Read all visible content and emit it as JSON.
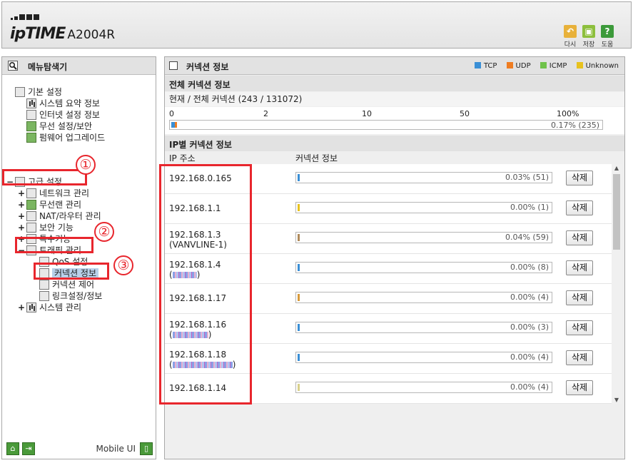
{
  "header": {
    "brand": "ipTIME",
    "model": "A2004R",
    "buttons": [
      {
        "label": "다시",
        "icon": "undo-icon",
        "color": "#e8b13a"
      },
      {
        "label": "저장",
        "icon": "save-icon",
        "color": "#8dbf3d"
      },
      {
        "label": "도움",
        "icon": "help-icon",
        "color": "#3c9a3a"
      }
    ]
  },
  "sidebar": {
    "title": "메뉴탐색기",
    "basic": {
      "label": "기본 설정",
      "items": [
        "시스템 요약 정보",
        "인터넷 설정 정보",
        "무선 설정/보안",
        "펌웨어 업그레이드"
      ]
    },
    "advanced": {
      "label": "고급 설정",
      "items": [
        "네트워크 관리",
        "무선랜 관리",
        "NAT/라우터 관리",
        "보안 기능",
        "특수기능"
      ],
      "traffic": {
        "label": "트래픽 관리",
        "items": [
          "QoS 설정",
          "커넥션 정보",
          "커넥션 제어",
          "링크설정/정보"
        ]
      },
      "system": "시스템 관리"
    },
    "annotations": [
      "①",
      "②",
      "③"
    ],
    "footer": {
      "mobile_ui": "Mobile UI"
    }
  },
  "main": {
    "title": "커넥션 정보",
    "legend": [
      {
        "label": "TCP",
        "color": "#3a8fd6"
      },
      {
        "label": "UDP",
        "color": "#ef7d22"
      },
      {
        "label": "ICMP",
        "color": "#6fc24a"
      },
      {
        "label": "Unknown",
        "color": "#e8c21e"
      }
    ],
    "total": {
      "heading": "전체 커넥션 정보",
      "summary": "현재 / 전체 커넥션 (243 / 131072)",
      "scale": [
        "0",
        "2",
        "10",
        "50",
        "100%"
      ],
      "bar_text": "0.17% (235)",
      "bar_fraction": 0.0017
    },
    "per_ip": {
      "heading": "IP별 커넥션 정보",
      "col_ip": "IP 주소",
      "col_info": "커넥션 정보",
      "delete_label": "삭제",
      "rows": [
        {
          "ip": "192.168.0.165",
          "sub": "",
          "text": "0.03% (51)",
          "color": "#3a8fd6"
        },
        {
          "ip": "192.168.1.1",
          "sub": "",
          "text": "0.00% (1)",
          "color": "#e8c21e"
        },
        {
          "ip": "192.168.1.3",
          "sub": "(VANVLINE-1)",
          "text": "0.04% (59)",
          "color": "#b08a5a"
        },
        {
          "ip": "192.168.1.4",
          "sub": "(",
          "text": "0.00% (8)",
          "color": "#3a8fd6"
        },
        {
          "ip": "192.168.1.17",
          "sub": "",
          "text": "0.00% (4)",
          "color": "#d89a3a"
        },
        {
          "ip": "192.168.1.16",
          "sub": "(",
          "text": "0.00% (3)",
          "color": "#3a8fd6"
        },
        {
          "ip": "192.168.1.18",
          "sub": "(",
          "text": "0.00% (4)",
          "color": "#3a8fd6"
        },
        {
          "ip": "192.168.1.14",
          "sub": "",
          "text": "0.00% (4)",
          "color": "#d8d08a"
        }
      ]
    }
  }
}
